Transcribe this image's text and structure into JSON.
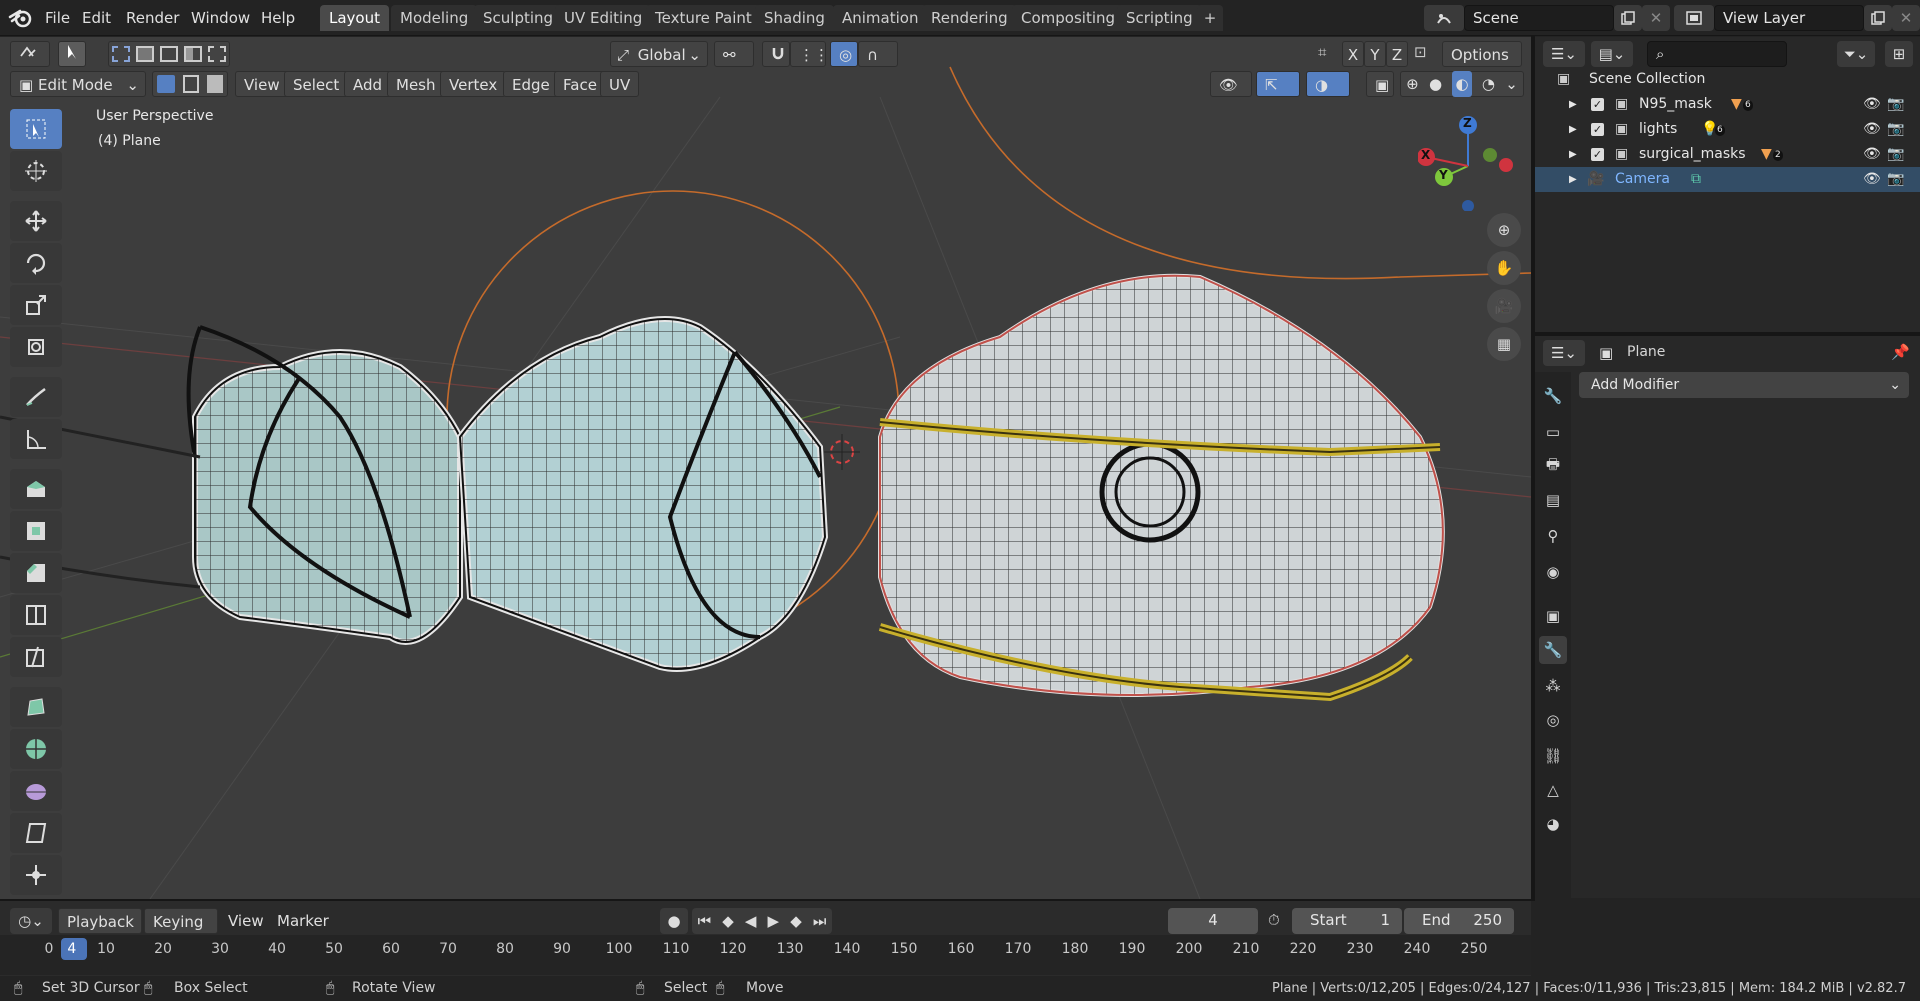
{
  "menu": {
    "items": [
      "File",
      "Edit",
      "Render",
      "Window",
      "Help"
    ]
  },
  "workspaces": {
    "tabs": [
      "Layout",
      "Modeling",
      "Sculpting",
      "UV Editing",
      "Texture Paint",
      "Shading",
      "Animation",
      "Rendering",
      "Compositing",
      "Scripting"
    ],
    "active": "Layout",
    "add": "+"
  },
  "scene": {
    "label": "Scene"
  },
  "view_layer": {
    "label": "View Layer"
  },
  "viewport": {
    "mode": "Edit Mode",
    "menus": [
      "View",
      "Select",
      "Add",
      "Mesh",
      "Vertex",
      "Edge",
      "Face",
      "UV"
    ],
    "transform_orientation": "Global",
    "axes": [
      "X",
      "Y",
      "Z"
    ],
    "options": "Options",
    "overlay_title": "User Perspective",
    "overlay_object": "(4) Plane",
    "gizmo": {
      "x": "X",
      "y": "Y",
      "z": "Z"
    }
  },
  "outliner": {
    "root": "Scene Collection",
    "rows": [
      {
        "name": "N95_mask",
        "badge": "6"
      },
      {
        "name": "lights",
        "badge": "6"
      },
      {
        "name": "surgical_masks",
        "badge": "2"
      },
      {
        "name": "Camera",
        "badge": ""
      }
    ]
  },
  "properties": {
    "object_name": "Plane",
    "add_modifier": "Add Modifier"
  },
  "timeline": {
    "menus": [
      "Playback",
      "Keying",
      "View",
      "Marker"
    ],
    "current_frame": "4",
    "start_label": "Start",
    "start": "1",
    "end_label": "End",
    "end": "250",
    "ruler": [
      "0",
      "4",
      "10",
      "20",
      "30",
      "40",
      "50",
      "60",
      "70",
      "80",
      "90",
      "100",
      "110",
      "120",
      "130",
      "140",
      "150",
      "160",
      "170",
      "180",
      "190",
      "200",
      "210",
      "220",
      "230",
      "240",
      "250"
    ]
  },
  "status": {
    "set_cursor": "Set 3D Cursor",
    "box_select": "Box Select",
    "rotate_view": "Rotate View",
    "select": "Select",
    "move": "Move",
    "stats": "Plane | Verts:0/12,205 | Edges:0/24,127 | Faces:0/11,936 | Tris:23,815 | Mem: 184.2 MiB | v2.82.7"
  },
  "colors": {
    "accent": "#5680c2",
    "selected_row": "#334d66",
    "camera_text": "#7fb6ff",
    "x": "#d0343f",
    "y": "#7ec73c",
    "z": "#3f7ad4"
  }
}
